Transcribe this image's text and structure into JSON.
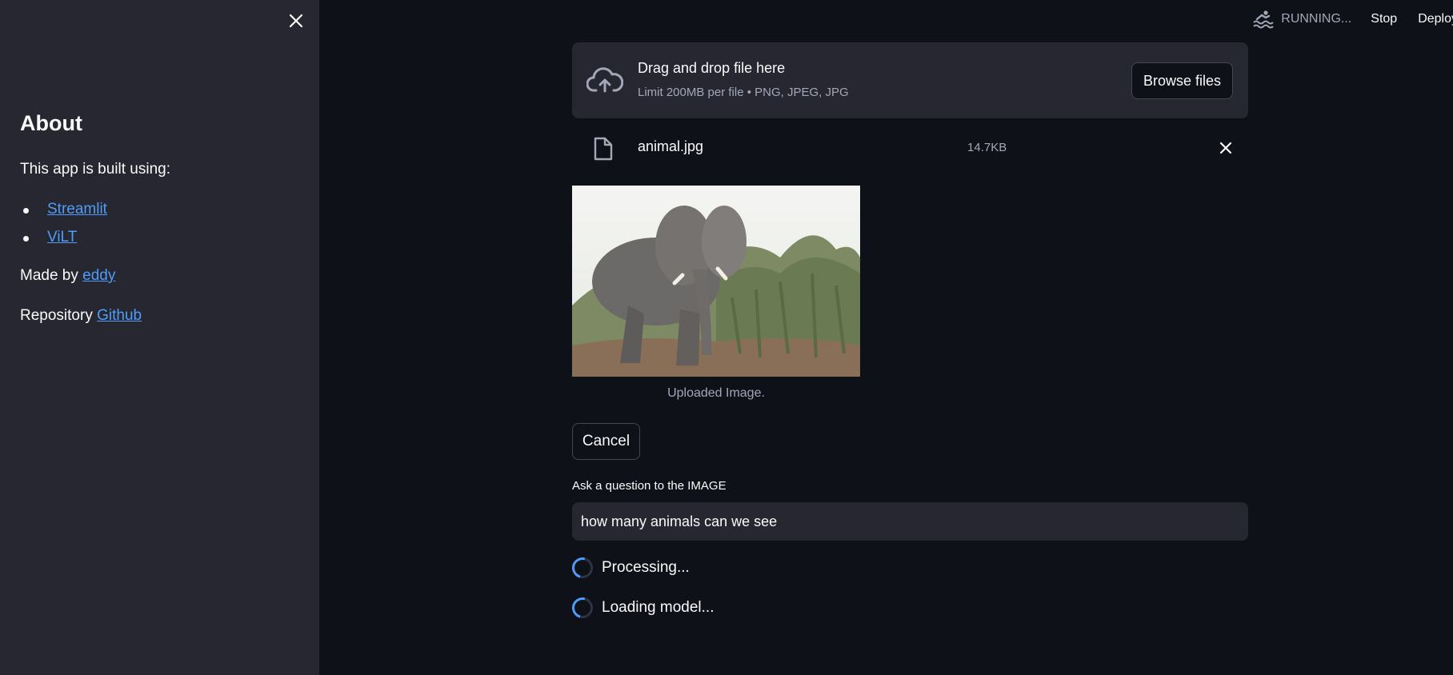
{
  "sidebar": {
    "title": "About",
    "built_with": "This app is built using:",
    "links": [
      "Streamlit",
      "ViLT"
    ],
    "made_by_prefix": "Made by ",
    "made_by_link": "eddy",
    "repo_prefix": "Repository ",
    "repo_link": "Github"
  },
  "header": {
    "status": "RUNNING...",
    "stop": "Stop",
    "deploy": "Deploy"
  },
  "uploader": {
    "title": "Drag and drop file here",
    "limit": "Limit 200MB per file • PNG, JPEG, JPG",
    "browse": "Browse files"
  },
  "file": {
    "name": "animal.jpg",
    "size": "14.7KB"
  },
  "image": {
    "caption": "Uploaded Image."
  },
  "cancel": "Cancel",
  "question": {
    "label": "Ask a question to the IMAGE",
    "value": "how many animals can we see"
  },
  "status": {
    "processing": "Processing...",
    "loading": "Loading model..."
  },
  "colors": {
    "background": "#0e1117",
    "sidebar": "#262730",
    "link": "#4f9cf9",
    "muted": "#a3a8b8"
  }
}
